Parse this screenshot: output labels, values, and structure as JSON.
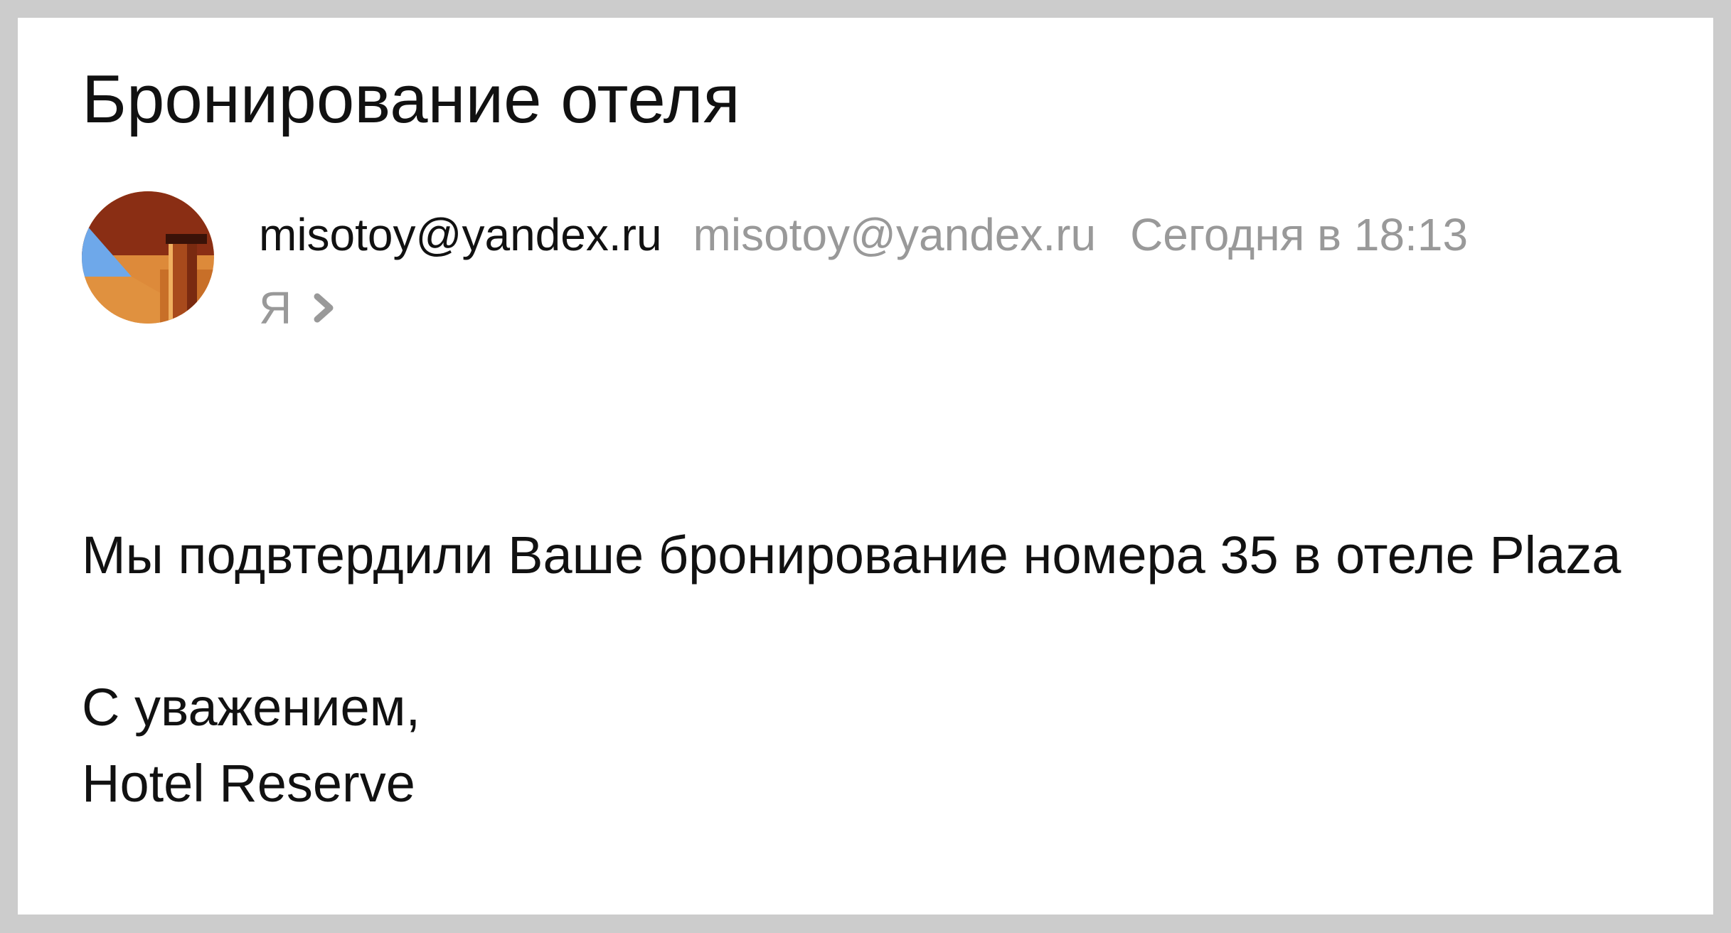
{
  "email": {
    "subject": "Бронирование отеля",
    "sender": {
      "name": "misotoy@yandex.ru",
      "email": "misotoy@yandex.ru",
      "avatar_icon": "user-avatar-photo"
    },
    "date": "Сегодня в 18:13",
    "recipient": {
      "label": "Я",
      "expand_icon": "chevron-right-icon"
    },
    "body": {
      "paragraph_1": "Мы подвтердили Ваше бронирование номера 35 в отеле Plaza",
      "closing": "С уважением,",
      "signature": "Hotel Reserve"
    }
  },
  "colors": {
    "background": "#cccccc",
    "card": "#ffffff",
    "text_primary": "#111111",
    "text_secondary": "#999999"
  }
}
